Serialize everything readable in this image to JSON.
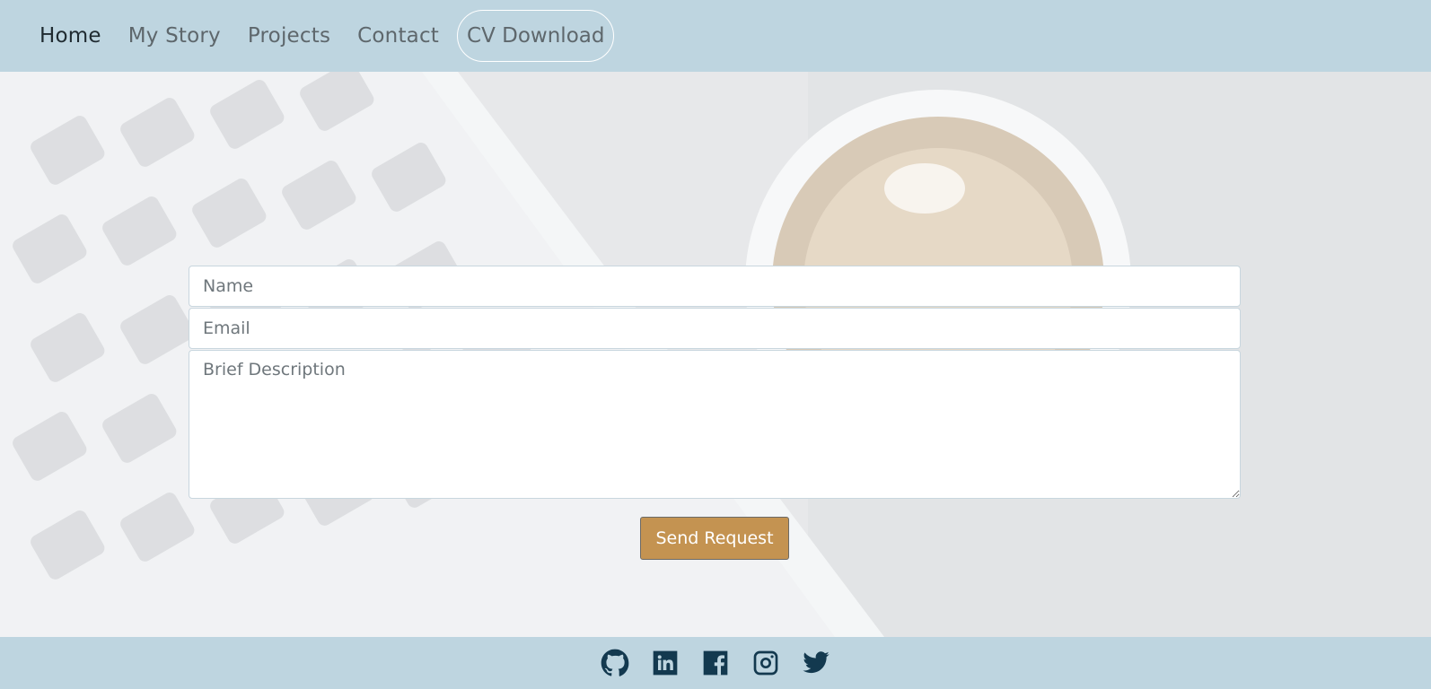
{
  "nav": {
    "items": [
      {
        "label": "Home",
        "active": true
      },
      {
        "label": "My Story",
        "active": false
      },
      {
        "label": "Projects",
        "active": false
      },
      {
        "label": "Contact",
        "active": false
      }
    ],
    "cv_label": "CV Download"
  },
  "form": {
    "name_placeholder": "Name",
    "email_placeholder": "Email",
    "description_placeholder": "Brief Description",
    "submit_label": "Send Request"
  },
  "footer": {
    "social_icons": [
      "github-icon",
      "linkedin-icon",
      "facebook-icon",
      "instagram-icon",
      "twitter-icon"
    ]
  },
  "colors": {
    "navbar_bg": "#bed5e0",
    "button_bg": "#c49351",
    "icon_color": "#13394f"
  }
}
